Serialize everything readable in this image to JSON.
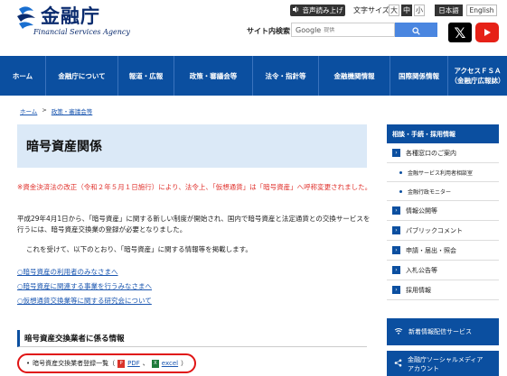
{
  "header": {
    "logo_jp": "金融庁",
    "logo_en": "Financial Services Agency",
    "voice_label": "音声読み上げ",
    "font_size_label": "文字サイズ",
    "font_sizes": [
      "大",
      "中",
      "小"
    ],
    "lang_jp": "日本語",
    "lang_en": "English",
    "search_label": "サイト内検索",
    "search_provider": "Google",
    "search_placeholder": "提供"
  },
  "nav": {
    "items": [
      {
        "label": "ホーム"
      },
      {
        "label": "金融庁について"
      },
      {
        "label": "報道・広報"
      },
      {
        "label": "政策・審議会等"
      },
      {
        "label": "法令・指針等"
      },
      {
        "label": "金融機関情報"
      },
      {
        "label": "国際関係情報"
      },
      {
        "label": "アクセスＦＳＡ\n（金融庁広報誌）"
      }
    ]
  },
  "breadcrumb": {
    "home": "ホーム",
    "sep": ">",
    "current": "政策・審議会等"
  },
  "main": {
    "title": "暗号資産関係",
    "notice": "※資金決済法の改正（令和２年５月１日施行）により、法令上、「仮想通貨」は「暗号資産」へ呼称変更されました。",
    "para1": "平成29年4月1日から、「暗号資産」に関する新しい制度が開始され、国内で暗号資産と法定通貨との交換サービスを行うには、暗号資産交換業の登録が必要となりました。",
    "para2": "これを受けて、以下のとおり、「暗号資産」に関する情報等を掲載します。",
    "links": [
      "○暗号資産の利用者のみなさまへ",
      "○暗号資産に関連する事業を行うみなさまへ",
      "○仮想通貨交換業等に関する研究会について"
    ],
    "section_title": "暗号資産交換業者に係る情報",
    "download": {
      "label": "暗号資産交換業者登録一覧（",
      "pdf": "PDF",
      "sep": "、",
      "excel": "excel",
      "close": "）"
    }
  },
  "sidebar": {
    "head": "相談・手続・採用情報",
    "items": [
      {
        "label": "各種窓口のご案内",
        "type": "main"
      },
      {
        "label": "金融サービス利用者相談室",
        "type": "sub"
      },
      {
        "label": "金融行政モニター",
        "type": "sub"
      },
      {
        "label": "情報公開等",
        "type": "main"
      },
      {
        "label": "パブリックコメント",
        "type": "main"
      },
      {
        "label": "申請・届出・照会",
        "type": "main"
      },
      {
        "label": "入札公告等",
        "type": "main"
      },
      {
        "label": "採用情報",
        "type": "main"
      }
    ],
    "btn_news": "新着情報配信サービス",
    "btn_social_1": "金融庁ソーシャルメディア",
    "btn_social_2": "アカウント"
  },
  "colors": {
    "nav_bg": "#0b4fa0",
    "title_bg": "#dbe9f7",
    "notice_red": "#e0322d",
    "highlight_red": "#e01414"
  }
}
